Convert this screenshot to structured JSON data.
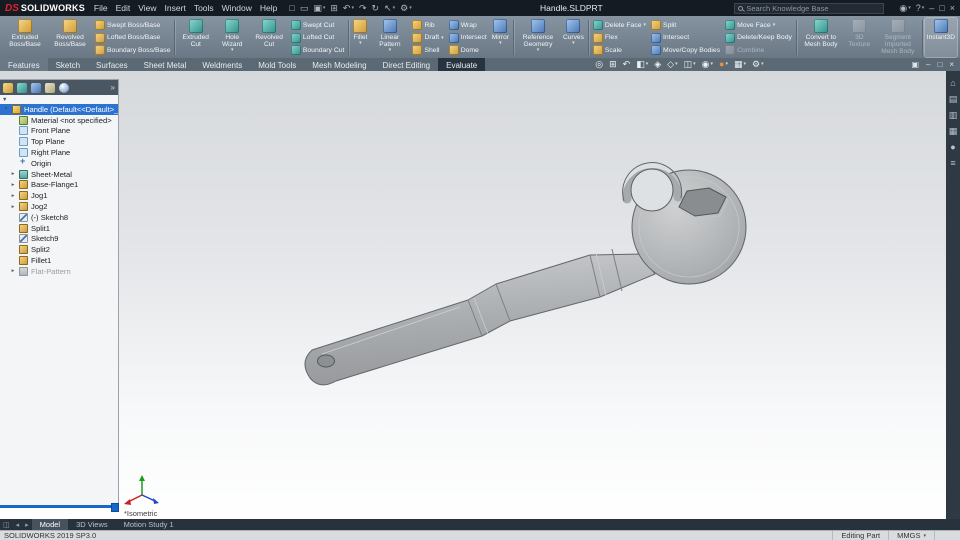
{
  "glyphs": {
    "caret": "▾"
  },
  "title_bar": {
    "logo_mark": "DS",
    "logo_text": "SOLIDWORKS",
    "menus": [
      "File",
      "Edit",
      "View",
      "Insert",
      "Tools",
      "Window",
      "Help"
    ],
    "quick_icons": [
      {
        "name": "new-file-icon",
        "glyph": "□"
      },
      {
        "name": "open-file-icon",
        "glyph": "▭"
      },
      {
        "name": "save-icon",
        "glyph": "▣",
        "caret": true
      },
      {
        "name": "print-icon",
        "glyph": "⊞"
      },
      {
        "name": "undo-icon",
        "glyph": "↶",
        "caret": true
      },
      {
        "name": "redo-icon",
        "glyph": "↷"
      },
      {
        "name": "rebuild-icon",
        "glyph": "↻"
      },
      {
        "name": "select-icon",
        "glyph": "↖",
        "caret": true
      },
      {
        "name": "options-icon",
        "glyph": "⚙",
        "caret": true
      }
    ],
    "document_title": "Handle.SLDPRT",
    "search_placeholder": "Search Knowledge Base",
    "right_icons": [
      {
        "name": "user-account-icon",
        "glyph": "◉",
        "caret": true
      },
      {
        "name": "help-icon",
        "glyph": "?",
        "caret": true
      },
      {
        "name": "minimize-window-icon",
        "glyph": "–"
      },
      {
        "name": "maximize-window-icon",
        "glyph": "□"
      },
      {
        "name": "close-window-icon",
        "glyph": "×"
      }
    ]
  },
  "ribbon": {
    "groups": [
      {
        "kind": "big",
        "items": [
          {
            "label": "Extruded Boss/Base",
            "icon": "extruded-boss-icon",
            "style": "gold"
          }
        ]
      },
      {
        "kind": "big",
        "items": [
          {
            "label": "Revolved Boss/Base",
            "icon": "revolved-boss-icon",
            "style": "gold"
          }
        ]
      },
      {
        "kind": "stack",
        "items": [
          {
            "label": "Swept Boss/Base",
            "icon": "swept-boss-icon",
            "style": "gold"
          },
          {
            "label": "Lofted Boss/Base",
            "icon": "lofted-boss-icon",
            "style": "gold"
          },
          {
            "label": "Boundary Boss/Base",
            "icon": "boundary-boss-icon",
            "style": "gold"
          }
        ]
      },
      {
        "kind": "sep"
      },
      {
        "kind": "big",
        "items": [
          {
            "label": "Extruded Cut",
            "icon": "extruded-cut-icon",
            "style": "teal"
          }
        ]
      },
      {
        "kind": "big",
        "items": [
          {
            "label": "Hole Wizard",
            "icon": "hole-wizard-icon",
            "style": "teal",
            "caret": true
          }
        ]
      },
      {
        "kind": "big",
        "items": [
          {
            "label": "Revolved Cut",
            "icon": "revolved-cut-icon",
            "style": "teal"
          }
        ]
      },
      {
        "kind": "stack",
        "items": [
          {
            "label": "Swept Cut",
            "icon": "swept-cut-icon",
            "style": "teal"
          },
          {
            "label": "Lofted Cut",
            "icon": "lofted-cut-icon",
            "style": "teal"
          },
          {
            "label": "Boundary Cut",
            "icon": "boundary-cut-icon",
            "style": "teal"
          }
        ]
      },
      {
        "kind": "sep"
      },
      {
        "kind": "big",
        "items": [
          {
            "label": "Fillet",
            "icon": "fillet-icon",
            "style": "gold",
            "caret": true
          }
        ]
      },
      {
        "kind": "big",
        "items": [
          {
            "label": "Linear Pattern",
            "icon": "linear-pattern-icon",
            "style": "blue",
            "caret": true
          }
        ]
      },
      {
        "kind": "stack",
        "items": [
          {
            "label": "Rib",
            "icon": "rib-icon",
            "style": "gold"
          },
          {
            "label": "Draft",
            "icon": "draft-icon",
            "style": "gold",
            "caret": true
          },
          {
            "label": "Shell",
            "icon": "shell-icon",
            "style": "gold"
          }
        ]
      },
      {
        "kind": "stack",
        "items": [
          {
            "label": "Wrap",
            "icon": "wrap-icon",
            "style": "blue"
          },
          {
            "label": "Intersect",
            "icon": "intersect-icon",
            "style": "blue"
          },
          {
            "label": "Dome",
            "icon": "dome-icon",
            "style": "gold"
          }
        ]
      },
      {
        "kind": "big",
        "items": [
          {
            "label": "Mirror",
            "icon": "mirror-icon",
            "style": "blue",
            "caret": true
          }
        ]
      },
      {
        "kind": "sep"
      },
      {
        "kind": "big",
        "items": [
          {
            "label": "Reference Geometry",
            "icon": "reference-geometry-icon",
            "style": "blue",
            "caret": true
          }
        ]
      },
      {
        "kind": "big",
        "items": [
          {
            "label": "Curves",
            "icon": "curves-icon",
            "style": "blue",
            "caret": true
          }
        ]
      },
      {
        "kind": "sep"
      },
      {
        "kind": "stack",
        "items": [
          {
            "label": "Delete Face",
            "icon": "delete-face-icon",
            "style": "teal",
            "caret": true
          },
          {
            "label": "Flex",
            "icon": "flex-icon",
            "style": "gold"
          },
          {
            "label": "Scale",
            "icon": "scale-icon",
            "style": "gold"
          }
        ]
      },
      {
        "kind": "stack",
        "items": [
          {
            "label": "Split",
            "icon": "split-icon",
            "style": "gold"
          },
          {
            "label": "Intersect",
            "icon": "intersect-bodies-icon",
            "style": "blue"
          },
          {
            "label": "Move/Copy Bodies",
            "icon": "move-copy-bodies-icon",
            "style": "blue"
          }
        ]
      },
      {
        "kind": "stack",
        "items": [
          {
            "label": "Move Face",
            "icon": "move-face-icon",
            "style": "teal",
            "caret": true
          },
          {
            "label": "Delete/Keep Body",
            "icon": "delete-keep-body-icon",
            "style": "teal"
          },
          {
            "label": "Combine",
            "icon": "combine-icon",
            "style": "gray",
            "disabled": true
          }
        ]
      },
      {
        "kind": "sep"
      },
      {
        "kind": "big",
        "items": [
          {
            "label": "Convert to Mesh Body",
            "icon": "convert-to-mesh-body-icon",
            "style": "teal"
          }
        ]
      },
      {
        "kind": "big",
        "items": [
          {
            "label": "3D Texture",
            "icon": "texture-3d-icon",
            "style": "gray",
            "disabled": true
          }
        ]
      },
      {
        "kind": "big",
        "items": [
          {
            "label": "Segment Imported Mesh Body",
            "icon": "segment-imported-mesh-body-icon",
            "style": "gray",
            "disabled": true
          }
        ]
      },
      {
        "kind": "sep"
      },
      {
        "kind": "big",
        "items": [
          {
            "label": "Instant3D",
            "icon": "instant3d-icon",
            "style": "blue",
            "active": true
          }
        ]
      }
    ]
  },
  "command_tabs": [
    {
      "label": "Features",
      "active": true
    },
    {
      "label": "Sketch"
    },
    {
      "label": "Surfaces"
    },
    {
      "label": "Sheet Metal"
    },
    {
      "label": "Weldments"
    },
    {
      "label": "Mold Tools"
    },
    {
      "label": "Mesh Modeling"
    },
    {
      "label": "Direct Editing"
    },
    {
      "label": "Evaluate",
      "dark": true
    }
  ],
  "headsup": [
    {
      "name": "zoom-to-fit",
      "glyph": "◎"
    },
    {
      "name": "zoom-to-area",
      "glyph": "⊞"
    },
    {
      "name": "previous-view",
      "glyph": "↶"
    },
    {
      "name": "section-view",
      "glyph": "◧",
      "caret": true
    },
    {
      "name": "dynamic-annotation-views",
      "glyph": "◈"
    },
    {
      "name": "view-orientation",
      "glyph": "◇",
      "caret": true
    },
    {
      "name": "display-style",
      "glyph": "◫",
      "caret": true
    },
    {
      "name": "hide-show-items",
      "glyph": "◉",
      "caret": true
    },
    {
      "name": "edit-appearance",
      "glyph": "●",
      "color": "#e8913a",
      "caret": true
    },
    {
      "name": "apply-scene",
      "glyph": "▦",
      "caret": true
    },
    {
      "name": "view-settings",
      "glyph": "⚙",
      "caret": true
    }
  ],
  "viewport": {
    "view_label": "*Isometric",
    "window_icons": [
      {
        "name": "viewport-restore-icon",
        "glyph": "▣"
      },
      {
        "name": "viewport-minimize-icon",
        "glyph": "–"
      },
      {
        "name": "viewport-maximize-icon",
        "glyph": "□"
      },
      {
        "name": "viewport-close-icon",
        "glyph": "×"
      }
    ]
  },
  "feature_tree": {
    "filter_glyph": "▼",
    "header_icons": [
      {
        "name": "featuremanager-tab-icon",
        "style": "gold"
      },
      {
        "name": "propertymanager-tab-icon",
        "style": "teal"
      },
      {
        "name": "configurationmanager-tab-icon",
        "style": "blue"
      },
      {
        "name": "dimxpertmanager-tab-icon",
        "style": "dim"
      },
      {
        "name": "displaymanager-tab-icon",
        "style": "ball"
      },
      {
        "name": "tab-overflow-icon",
        "style": "chev",
        "glyph": "»"
      }
    ],
    "items": [
      {
        "label": "Handle (Default<<Default>_Display Sta",
        "icon": "part",
        "selected": true,
        "arrow": "▾",
        "indent": 0
      },
      {
        "label": "Material <not specified>",
        "icon": "material",
        "indent": 1
      },
      {
        "label": "Front Plane",
        "icon": "plane",
        "indent": 1
      },
      {
        "label": "Top Plane",
        "icon": "plane",
        "indent": 1
      },
      {
        "label": "Right Plane",
        "icon": "plane",
        "indent": 1
      },
      {
        "label": "Origin",
        "icon": "origin",
        "indent": 1
      },
      {
        "label": "Sheet-Metal",
        "icon": "folder",
        "indent": 1,
        "arrow": "▸"
      },
      {
        "label": "Base-Flange1",
        "icon": "feature",
        "indent": 1,
        "arrow": "▸"
      },
      {
        "label": "Jog1",
        "icon": "feature",
        "indent": 1,
        "arrow": "▸"
      },
      {
        "label": "Jog2",
        "icon": "feature",
        "indent": 1,
        "arrow": "▸"
      },
      {
        "label": "(-) Sketch8",
        "icon": "sketch",
        "indent": 1
      },
      {
        "label": "Split1",
        "icon": "feature",
        "indent": 1
      },
      {
        "label": "Sketch9",
        "icon": "sketch",
        "indent": 1
      },
      {
        "label": "Split2",
        "icon": "feature",
        "indent": 1
      },
      {
        "label": "Fillet1",
        "icon": "feature",
        "indent": 1
      },
      {
        "label": "Flat-Pattern",
        "icon": "folder-gray",
        "indent": 1,
        "arrow": "▸",
        "disabled": true
      }
    ]
  },
  "task_pane": [
    {
      "name": "solidworks-resources-icon",
      "glyph": "⌂"
    },
    {
      "name": "design-library-icon",
      "glyph": "▤"
    },
    {
      "name": "file-explorer-icon",
      "glyph": "▥"
    },
    {
      "name": "view-palette-icon",
      "glyph": "▦"
    },
    {
      "name": "appearances-scenes-icon",
      "glyph": "●"
    },
    {
      "name": "custom-properties-icon",
      "glyph": "≡"
    }
  ],
  "model_tabs": {
    "nav_icons": [
      {
        "name": "pane-layout-icon",
        "glyph": "◫"
      },
      {
        "name": "tab-scroll-left-icon",
        "glyph": "◂"
      },
      {
        "name": "tab-scroll-right-icon",
        "glyph": "▸"
      }
    ],
    "tabs": [
      {
        "label": "Model",
        "active": true
      },
      {
        "label": "3D Views"
      },
      {
        "label": "Motion Study 1"
      }
    ]
  },
  "status_bar": {
    "app_version": "SOLIDWORKS 2019 SP3.0",
    "mode": "Editing Part",
    "units": "MMGS",
    "units_caret": "▾"
  }
}
